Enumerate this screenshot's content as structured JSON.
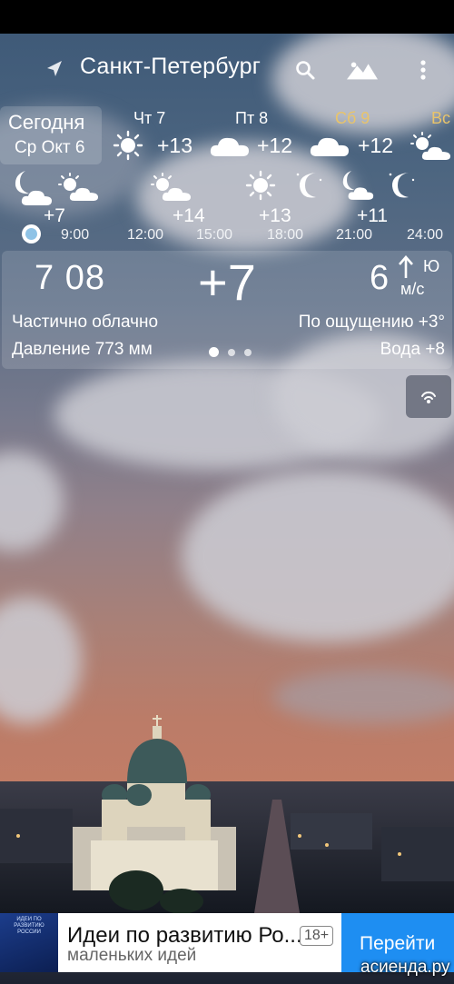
{
  "toolbar": {
    "city": "Санкт-Петербург",
    "location_icon": "location-arrow-icon",
    "search_icon": "search-icon",
    "background_icon": "mountains-icon",
    "menu_icon": "more-vert-icon"
  },
  "daily": {
    "today_label": "Сегодня",
    "today_date": "Ср Окт 6",
    "days": [
      {
        "name": "Чт 7",
        "temp": "+13",
        "icon": "sun-icon"
      },
      {
        "name": "Пт 8",
        "temp": "+12",
        "icon": "cloud-icon"
      },
      {
        "name": "Сб 9",
        "temp": "+12",
        "icon": "cloud-icon"
      },
      {
        "name": "Вс",
        "temp": "",
        "icon": "partly-cloudy-icon"
      }
    ]
  },
  "hourly": {
    "temps": [
      "+7",
      "+14",
      "+13",
      "+11"
    ],
    "times": [
      "9:00",
      "12:00",
      "15:00",
      "18:00",
      "21:00",
      "24:00"
    ]
  },
  "current": {
    "time": "7 08",
    "temp": "+7",
    "wind_speed": "6",
    "wind_dir": "Ю",
    "wind_unit": "м/с",
    "condition": "Частично облачно",
    "feels_like": "По ощущению +3°",
    "pressure": "Давление 773 мм",
    "water": "Вода +8",
    "page_index": 1,
    "page_count": 3
  },
  "radar_icon": "radar-icon",
  "ad": {
    "thumb_text": "ИДЕИ ПО РАЗВИТИЮ РОССИИ",
    "title": "Идеи по развитию Ро...",
    "age": "18+",
    "subtitle": "маленьких идей",
    "button": "Перейти",
    "watermark": "асиенда.ру"
  },
  "colors": {
    "sky_top": "#3f5a78",
    "sky_bottom": "#c27d66",
    "saturday": "#e9c46a",
    "ad_button": "#1e8ef2"
  }
}
